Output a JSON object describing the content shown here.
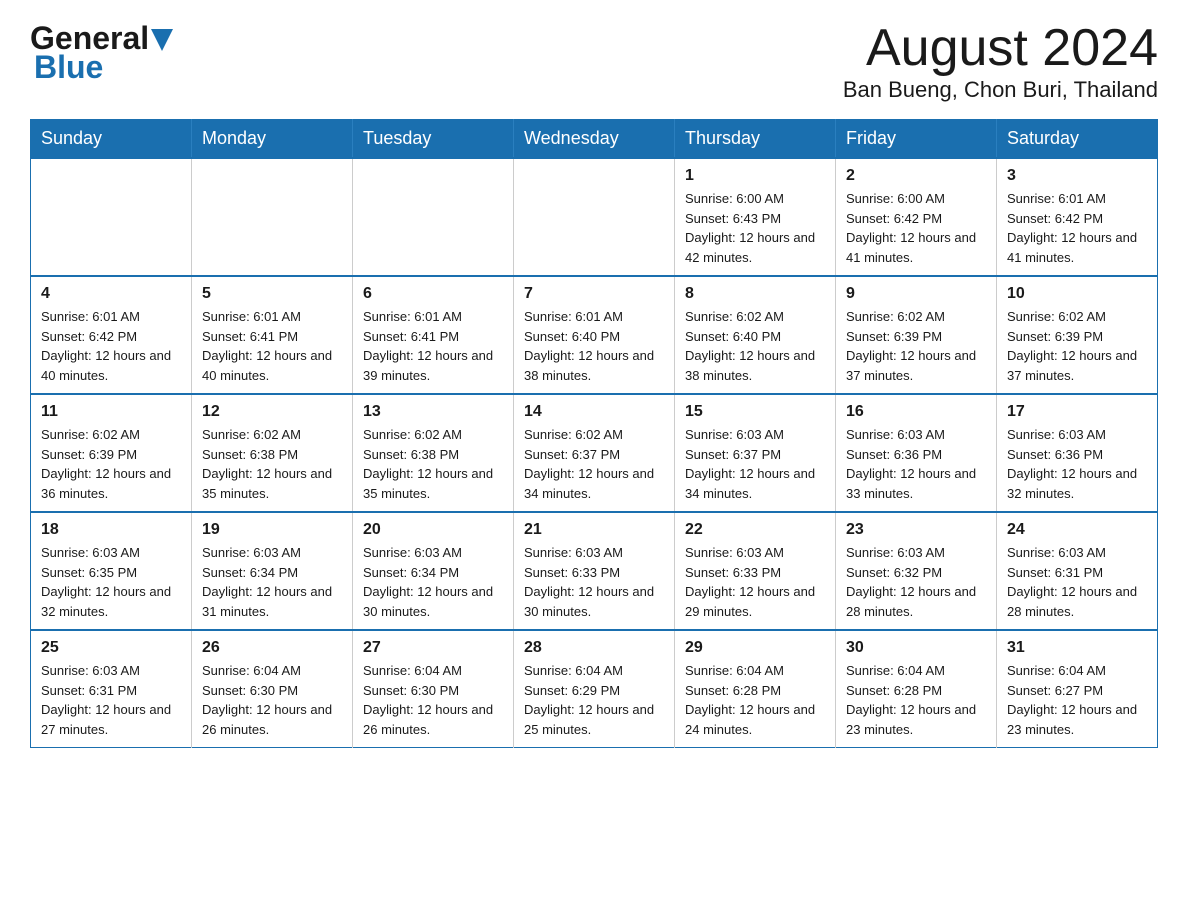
{
  "header": {
    "logo_general": "General",
    "logo_blue": "Blue",
    "month_title": "August 2024",
    "location": "Ban Bueng, Chon Buri, Thailand"
  },
  "weekdays": [
    "Sunday",
    "Monday",
    "Tuesday",
    "Wednesday",
    "Thursday",
    "Friday",
    "Saturday"
  ],
  "weeks": [
    [
      {
        "day": "",
        "info": ""
      },
      {
        "day": "",
        "info": ""
      },
      {
        "day": "",
        "info": ""
      },
      {
        "day": "",
        "info": ""
      },
      {
        "day": "1",
        "info": "Sunrise: 6:00 AM\nSunset: 6:43 PM\nDaylight: 12 hours and 42 minutes."
      },
      {
        "day": "2",
        "info": "Sunrise: 6:00 AM\nSunset: 6:42 PM\nDaylight: 12 hours and 41 minutes."
      },
      {
        "day": "3",
        "info": "Sunrise: 6:01 AM\nSunset: 6:42 PM\nDaylight: 12 hours and 41 minutes."
      }
    ],
    [
      {
        "day": "4",
        "info": "Sunrise: 6:01 AM\nSunset: 6:42 PM\nDaylight: 12 hours and 40 minutes."
      },
      {
        "day": "5",
        "info": "Sunrise: 6:01 AM\nSunset: 6:41 PM\nDaylight: 12 hours and 40 minutes."
      },
      {
        "day": "6",
        "info": "Sunrise: 6:01 AM\nSunset: 6:41 PM\nDaylight: 12 hours and 39 minutes."
      },
      {
        "day": "7",
        "info": "Sunrise: 6:01 AM\nSunset: 6:40 PM\nDaylight: 12 hours and 38 minutes."
      },
      {
        "day": "8",
        "info": "Sunrise: 6:02 AM\nSunset: 6:40 PM\nDaylight: 12 hours and 38 minutes."
      },
      {
        "day": "9",
        "info": "Sunrise: 6:02 AM\nSunset: 6:39 PM\nDaylight: 12 hours and 37 minutes."
      },
      {
        "day": "10",
        "info": "Sunrise: 6:02 AM\nSunset: 6:39 PM\nDaylight: 12 hours and 37 minutes."
      }
    ],
    [
      {
        "day": "11",
        "info": "Sunrise: 6:02 AM\nSunset: 6:39 PM\nDaylight: 12 hours and 36 minutes."
      },
      {
        "day": "12",
        "info": "Sunrise: 6:02 AM\nSunset: 6:38 PM\nDaylight: 12 hours and 35 minutes."
      },
      {
        "day": "13",
        "info": "Sunrise: 6:02 AM\nSunset: 6:38 PM\nDaylight: 12 hours and 35 minutes."
      },
      {
        "day": "14",
        "info": "Sunrise: 6:02 AM\nSunset: 6:37 PM\nDaylight: 12 hours and 34 minutes."
      },
      {
        "day": "15",
        "info": "Sunrise: 6:03 AM\nSunset: 6:37 PM\nDaylight: 12 hours and 34 minutes."
      },
      {
        "day": "16",
        "info": "Sunrise: 6:03 AM\nSunset: 6:36 PM\nDaylight: 12 hours and 33 minutes."
      },
      {
        "day": "17",
        "info": "Sunrise: 6:03 AM\nSunset: 6:36 PM\nDaylight: 12 hours and 32 minutes."
      }
    ],
    [
      {
        "day": "18",
        "info": "Sunrise: 6:03 AM\nSunset: 6:35 PM\nDaylight: 12 hours and 32 minutes."
      },
      {
        "day": "19",
        "info": "Sunrise: 6:03 AM\nSunset: 6:34 PM\nDaylight: 12 hours and 31 minutes."
      },
      {
        "day": "20",
        "info": "Sunrise: 6:03 AM\nSunset: 6:34 PM\nDaylight: 12 hours and 30 minutes."
      },
      {
        "day": "21",
        "info": "Sunrise: 6:03 AM\nSunset: 6:33 PM\nDaylight: 12 hours and 30 minutes."
      },
      {
        "day": "22",
        "info": "Sunrise: 6:03 AM\nSunset: 6:33 PM\nDaylight: 12 hours and 29 minutes."
      },
      {
        "day": "23",
        "info": "Sunrise: 6:03 AM\nSunset: 6:32 PM\nDaylight: 12 hours and 28 minutes."
      },
      {
        "day": "24",
        "info": "Sunrise: 6:03 AM\nSunset: 6:31 PM\nDaylight: 12 hours and 28 minutes."
      }
    ],
    [
      {
        "day": "25",
        "info": "Sunrise: 6:03 AM\nSunset: 6:31 PM\nDaylight: 12 hours and 27 minutes."
      },
      {
        "day": "26",
        "info": "Sunrise: 6:04 AM\nSunset: 6:30 PM\nDaylight: 12 hours and 26 minutes."
      },
      {
        "day": "27",
        "info": "Sunrise: 6:04 AM\nSunset: 6:30 PM\nDaylight: 12 hours and 26 minutes."
      },
      {
        "day": "28",
        "info": "Sunrise: 6:04 AM\nSunset: 6:29 PM\nDaylight: 12 hours and 25 minutes."
      },
      {
        "day": "29",
        "info": "Sunrise: 6:04 AM\nSunset: 6:28 PM\nDaylight: 12 hours and 24 minutes."
      },
      {
        "day": "30",
        "info": "Sunrise: 6:04 AM\nSunset: 6:28 PM\nDaylight: 12 hours and 23 minutes."
      },
      {
        "day": "31",
        "info": "Sunrise: 6:04 AM\nSunset: 6:27 PM\nDaylight: 12 hours and 23 minutes."
      }
    ]
  ]
}
